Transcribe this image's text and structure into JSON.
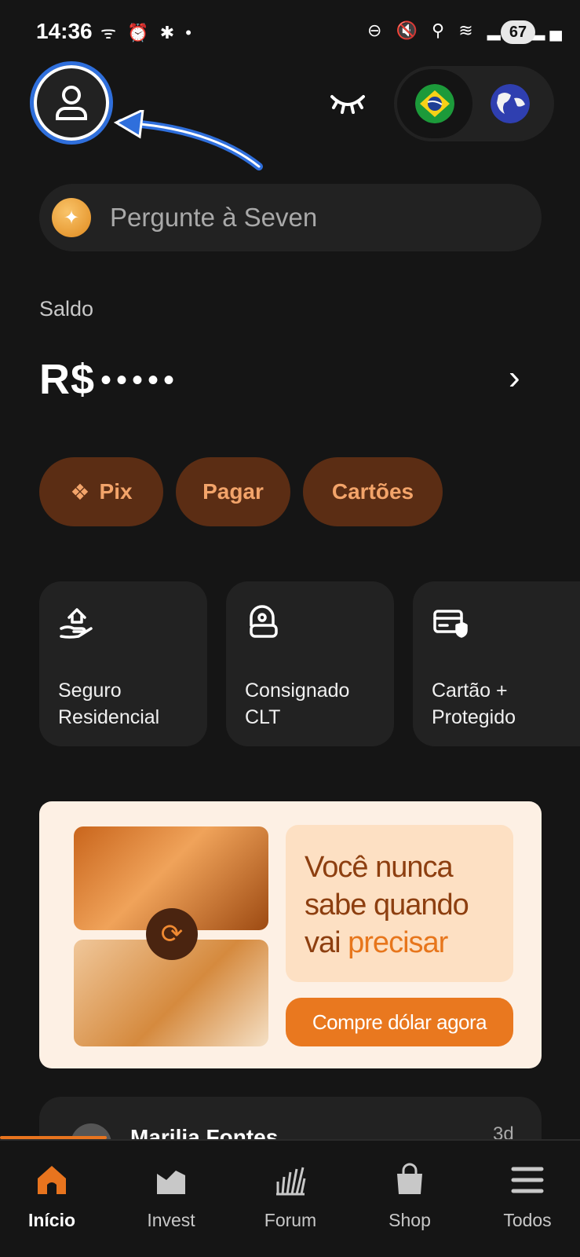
{
  "status_bar": {
    "time": "14:36",
    "left_icons": "ᯤ ⏰ ✱ •",
    "right_icons": "⊖ 🔇 ⚲ ≋ ▂▄ ▂▄",
    "battery": "67"
  },
  "header": {
    "profile_icon": "user-icon",
    "eye_icon": "eye-closed-icon",
    "regions": [
      {
        "name": "brazil-flag",
        "active": true
      },
      {
        "name": "globe-icon",
        "active": false
      }
    ]
  },
  "ask_bar": {
    "icon": "sparkle-icon",
    "placeholder": "Pergunte à Seven"
  },
  "balance": {
    "label": "Saldo",
    "currency": "R$",
    "masked": "•••••",
    "chevron": "›"
  },
  "quick_actions": [
    {
      "label": "Pix",
      "icon": "pix-icon"
    },
    {
      "label": "Pagar"
    },
    {
      "label": "Cartões"
    }
  ],
  "cards": [
    {
      "label": "Seguro\nResidencial",
      "icon": "home-insurance-icon"
    },
    {
      "label": "Consignado\nCLT",
      "icon": "loan-icon"
    },
    {
      "label": "Cartão +\nProtegido",
      "icon": "card-shield-icon"
    }
  ],
  "banner": {
    "headline_1": "Você nunca",
    "headline_2": "sabe quando",
    "headline_3_a": "vai ",
    "headline_3_b": "precisar",
    "cta": "Compre dólar agora",
    "swap_icon": "swap-icon"
  },
  "feed_preview": {
    "name": "Marilia Fontes",
    "time": "3d"
  },
  "bottom_nav": [
    {
      "label": "Início",
      "icon": "home-icon",
      "active": true
    },
    {
      "label": "Invest",
      "icon": "chart-icon",
      "active": false
    },
    {
      "label": "Forum",
      "icon": "forum-icon",
      "active": false
    },
    {
      "label": "Shop",
      "icon": "bag-icon",
      "active": false
    },
    {
      "label": "Todos",
      "icon": "menu-icon",
      "active": false
    }
  ],
  "colors": {
    "background": "#151515",
    "surface": "#222222",
    "accent": "#e8741e",
    "pill_bg": "#5b2d14",
    "pill_text": "#f3a46a",
    "highlight_ring": "#2f6fdc"
  }
}
